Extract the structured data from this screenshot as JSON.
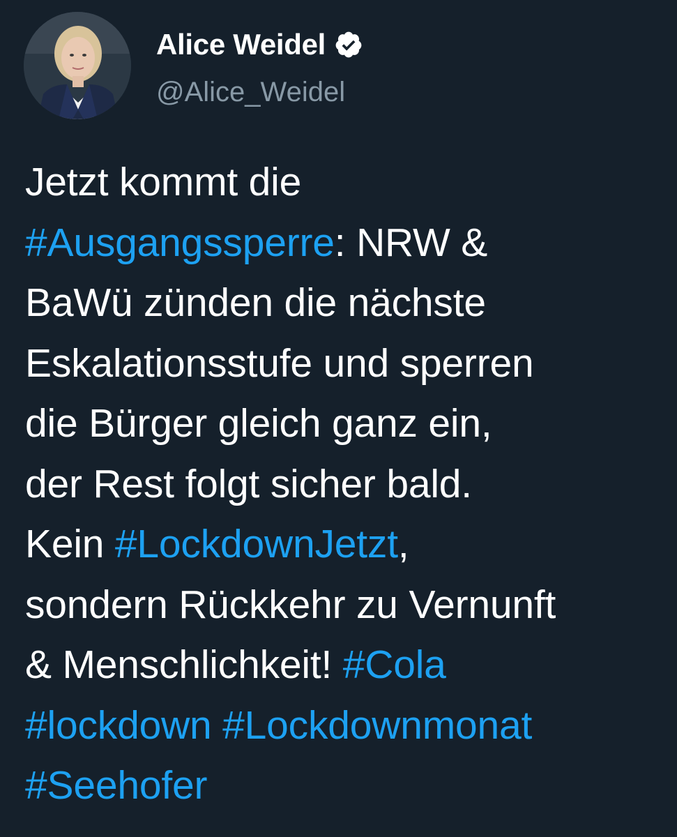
{
  "user": {
    "display_name": "Alice Weidel",
    "handle": "@Alice_Weidel",
    "verified": true,
    "avatar_icon": "profile-photo"
  },
  "tweet": {
    "lines": [
      [
        {
          "text": "Jetzt kommt die",
          "tag": false
        }
      ],
      [
        {
          "text": "#Ausgangssperre",
          "tag": true
        },
        {
          "text": ": NRW &",
          "tag": false
        }
      ],
      [
        {
          "text": "BaWü zünden die nächste",
          "tag": false
        }
      ],
      [
        {
          "text": "Eskalationsstufe und sperren",
          "tag": false
        }
      ],
      [
        {
          "text": "die Bürger gleich ganz ein,",
          "tag": false
        }
      ],
      [
        {
          "text": "der Rest folgt sicher bald.",
          "tag": false
        }
      ],
      [
        {
          "text": "Kein ",
          "tag": false
        },
        {
          "text": "#LockdownJetzt",
          "tag": true
        },
        {
          "text": ",",
          "tag": false
        }
      ],
      [
        {
          "text": "sondern Rückkehr zu Vernunft",
          "tag": false
        }
      ],
      [
        {
          "text": "& Menschlichkeit! ",
          "tag": false
        },
        {
          "text": "#Cola",
          "tag": true
        }
      ],
      [
        {
          "text": "#lockdown",
          "tag": true
        },
        {
          "text": " ",
          "tag": false
        },
        {
          "text": "#Lockdownmonat",
          "tag": true
        }
      ],
      [
        {
          "text": "#Seehofer",
          "tag": true
        }
      ]
    ]
  },
  "colors": {
    "background": "#15202b",
    "text": "#ffffff",
    "hashtag": "#1da1f2",
    "handle": "#8899a6"
  }
}
